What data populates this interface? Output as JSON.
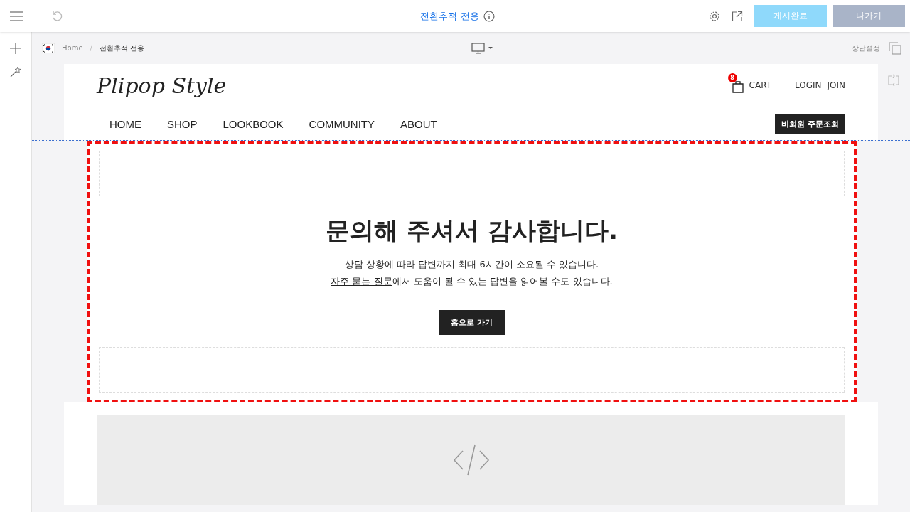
{
  "topbar": {
    "title": "전환추적 전용",
    "publish_button": "게시완료",
    "exit_button": "나가기"
  },
  "breadcrumb": {
    "items": [
      "Home",
      "전환추적 전용"
    ],
    "separator": "/",
    "settings_link": "상단설정"
  },
  "site": {
    "logo": "Plipop Style",
    "cart_label": "CART",
    "cart_count": "8",
    "account_links": [
      "LOGIN",
      "JOIN"
    ],
    "nav": [
      "HOME",
      "SHOP",
      "LOOKBOOK",
      "COMMUNITY",
      "ABOUT"
    ],
    "guest_order_button": "비회원 주문조회"
  },
  "section": {
    "heading": "문의해 주셔서 감사합니다.",
    "line_1": "상담 상황에 따라 답변까지 최대 6시간이 소요될 수 있습니다.",
    "faq_link": "자주 묻는 질문",
    "line_2_rest": "에서 도움이 될 수 있는 답변을 읽어볼 수도 있습니다.",
    "home_button": "홈으로 가기"
  }
}
